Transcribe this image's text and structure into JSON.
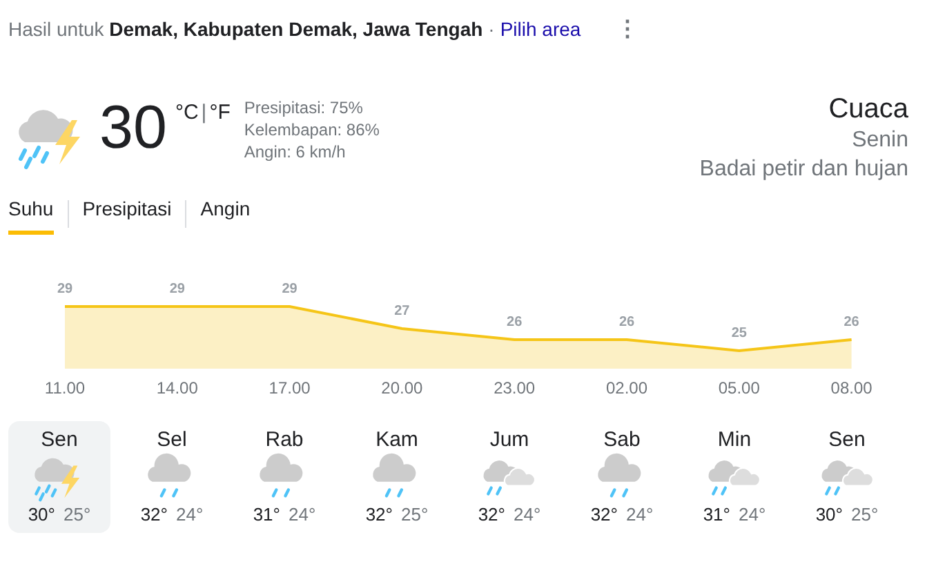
{
  "header": {
    "prefix": "Hasil untuk",
    "location": "Demak, Kabupaten Demak, Jawa Tengah",
    "separator": "·",
    "link": "Pilih area",
    "menu": "⋮"
  },
  "current": {
    "kind": "storm",
    "temp": "30",
    "unit_c": "°C",
    "unit_sep": "|",
    "unit_f": "°F",
    "details": [
      "Presipitasi: 75%",
      "Kelembapan: 86%",
      "Angin: 6 km/h"
    ],
    "title": "Cuaca",
    "day": "Senin",
    "condition": "Badai petir dan hujan"
  },
  "tabs": [
    {
      "label": "Suhu",
      "selected": true
    },
    {
      "label": "Presipitasi",
      "selected": false
    },
    {
      "label": "Angin",
      "selected": false
    }
  ],
  "chart": {
    "chart_data": {
      "type": "area",
      "categories": [
        "11.00",
        "14.00",
        "17.00",
        "20.00",
        "23.00",
        "02.00",
        "05.00",
        "08.00"
      ],
      "data_labels": true,
      "series": [
        {
          "color": "#f5c518",
          "values": [
            29,
            29,
            29,
            27,
            26,
            26,
            25,
            26
          ]
        }
      ]
    }
  },
  "days": [
    {
      "day": "Sen",
      "kind": "storm",
      "high": "30°",
      "low": "25°",
      "selected": true
    },
    {
      "day": "Sel",
      "kind": "rain",
      "high": "32°",
      "low": "24°",
      "selected": false
    },
    {
      "day": "Rab",
      "kind": "rain",
      "high": "31°",
      "low": "24°",
      "selected": false
    },
    {
      "day": "Kam",
      "kind": "rain",
      "high": "32°",
      "low": "25°",
      "selected": false
    },
    {
      "day": "Jum",
      "kind": "clouds_rain",
      "high": "32°",
      "low": "24°",
      "selected": false
    },
    {
      "day": "Sab",
      "kind": "rain",
      "high": "32°",
      "low": "24°",
      "selected": false
    },
    {
      "day": "Min",
      "kind": "clouds_rain",
      "high": "31°",
      "low": "24°",
      "selected": false
    },
    {
      "day": "Sen",
      "kind": "clouds_rain",
      "high": "30°",
      "low": "25°",
      "selected": false
    }
  ]
}
